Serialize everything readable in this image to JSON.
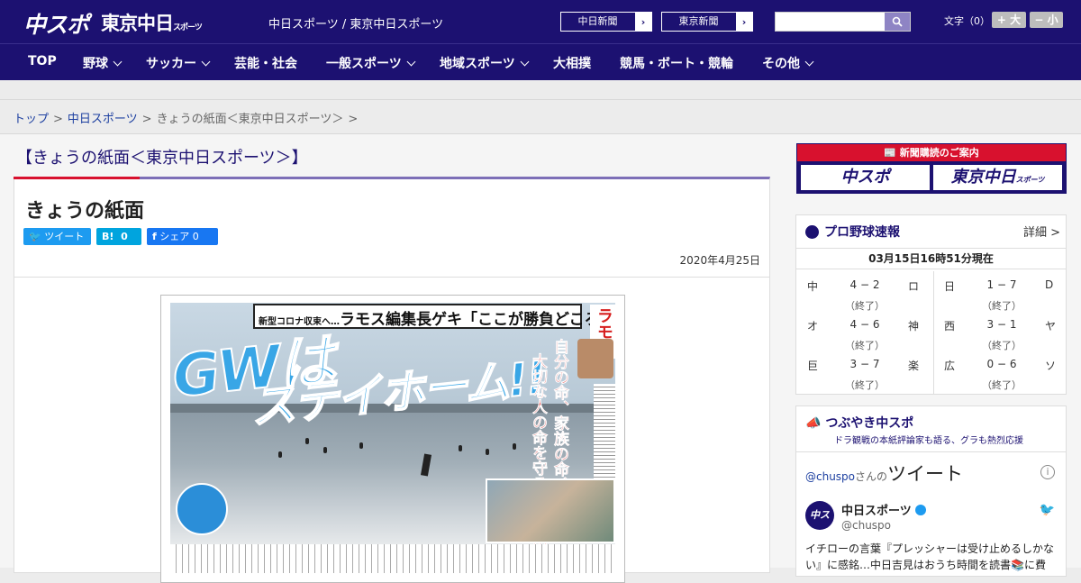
{
  "header": {
    "logo_primary": "中スポ",
    "logo_secondary": "東京中日",
    "logo_secondary_small": "スポーツ",
    "site_link": "中日スポーツ / 東京中日スポーツ",
    "paper_links": [
      "中日新聞",
      "東京新聞"
    ],
    "search": {
      "placeholder": ""
    },
    "font_size_label": "文字（0）",
    "font_bigger": "+ 大",
    "font_smaller": "− 小"
  },
  "nav": {
    "items": [
      {
        "label": "TOP",
        "dropdown": false
      },
      {
        "label": "野球",
        "dropdown": true
      },
      {
        "label": "サッカー",
        "dropdown": true
      },
      {
        "label": "芸能・社会",
        "dropdown": false
      },
      {
        "label": "一般スポーツ",
        "dropdown": true
      },
      {
        "label": "地域スポーツ",
        "dropdown": true
      },
      {
        "label": "大相撲",
        "dropdown": false
      },
      {
        "label": "競馬・ボート・競輪",
        "dropdown": false
      },
      {
        "label": "その他",
        "dropdown": true
      }
    ]
  },
  "breadcrumb": {
    "items": [
      "トップ",
      "中日スポーツ",
      "きょうの紙面＜東京中日スポーツ＞"
    ],
    "separator": ">"
  },
  "page": {
    "title": "【きょうの紙面＜東京中日スポーツ＞】",
    "article_title": "きょうの紙面",
    "share": {
      "tweet": "ツイート",
      "hatena": "B!",
      "hatena_count": "0",
      "facebook": "シェア",
      "facebook_count": "0"
    },
    "date": "2020年4月25日"
  },
  "newspaper": {
    "band_small": "新型コロナ収束へ…",
    "band_main": "ラモス編集長ゲキ「ここが勝負どころ」",
    "headline_1": "GWは",
    "headline_2": "ステイホーム!!",
    "vertical_1": "自分の命、家族の命、",
    "vertical_2": "大切な人の命を守る戦争なのだ",
    "corner": "ラモス"
  },
  "sidebar": {
    "ad": {
      "banner": "新聞購読のご案内",
      "logo_1": "中スポ",
      "logo_2": "東京中日",
      "logo_2_small": "スポーツ"
    },
    "baseball": {
      "title": "プロ野球速報",
      "detail": "詳細 >",
      "as_of": "03月15日16時51分現在",
      "games": [
        {
          "home": "中",
          "score": "4 − 2",
          "away": "ロ",
          "status": "（終了）"
        },
        {
          "home": "日",
          "score": "1 − 7",
          "away": "D",
          "status": "（終了）"
        },
        {
          "home": "オ",
          "score": "4 − 6",
          "away": "神",
          "status": "（終了）"
        },
        {
          "home": "西",
          "score": "3 − 1",
          "away": "ヤ",
          "status": "（終了）"
        },
        {
          "home": "巨",
          "score": "3 − 7",
          "away": "楽",
          "status": "（終了）"
        },
        {
          "home": "広",
          "score": "0 − 6",
          "away": "ソ",
          "status": "（終了）"
        }
      ]
    },
    "twitter": {
      "title": "つぶやき中スポ",
      "subtitle": "ドラ観戦の本紙評論家も語る、グラも熱烈応援",
      "embed_handle_link": "@chuspo",
      "embed_suffix": "さんの",
      "embed_big": "ツイート",
      "avatar": "中スポ",
      "name": "中日スポーツ",
      "handle": "@chuspo",
      "text": "イチローの言葉『プレッシャーは受け止めるしかない』に感銘…中日吉見はおうち時間を読書📚に費"
    }
  },
  "colors": {
    "brand": "#1c1171",
    "accent_red": "#d8112e",
    "twitter_blue": "#1d9bf0",
    "facebook_blue": "#1877f2",
    "hatena_blue": "#00a4de"
  }
}
